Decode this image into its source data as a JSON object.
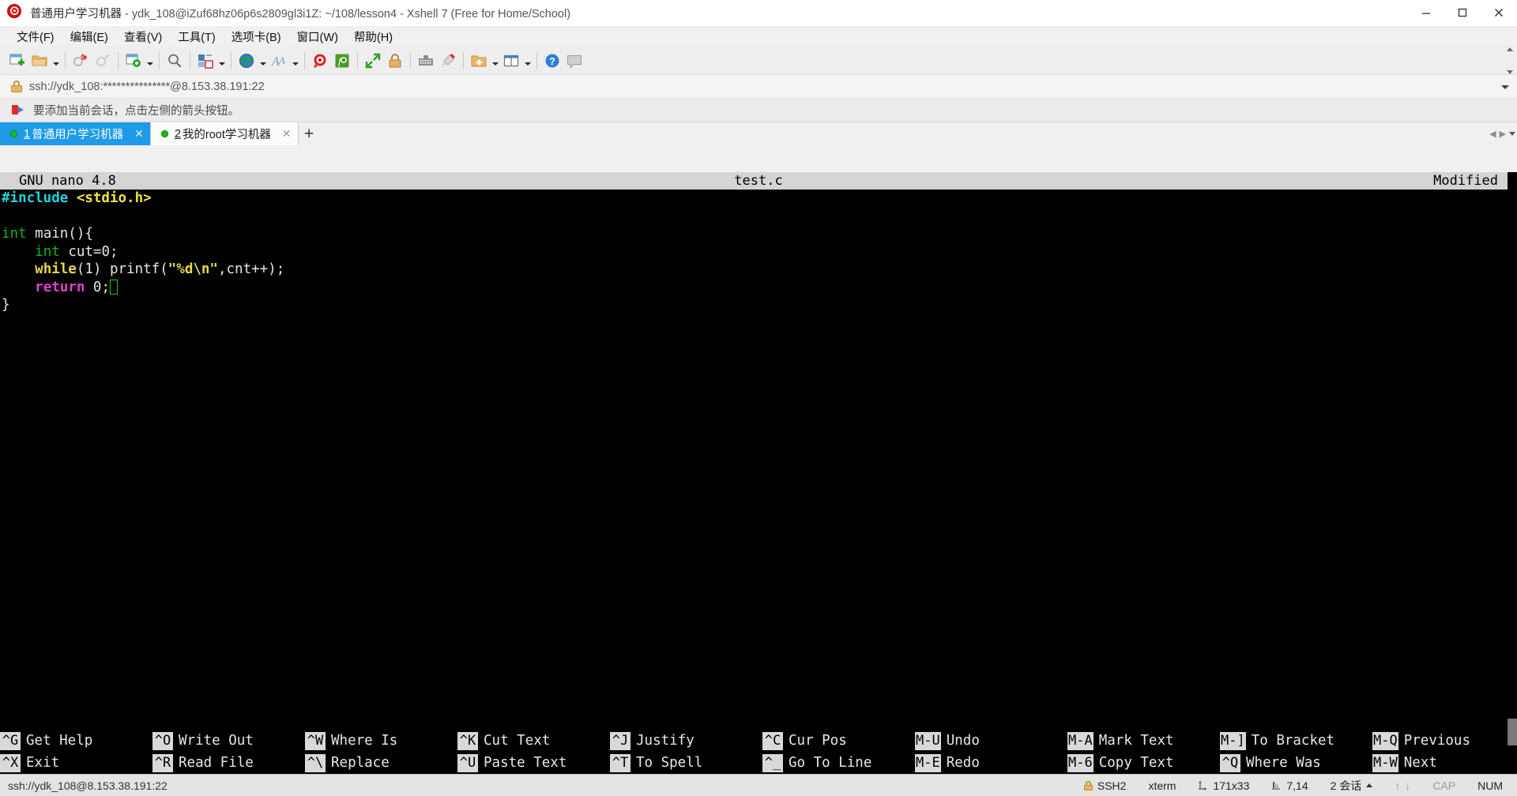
{
  "window": {
    "title_main": "普通用户学习机器",
    "title_rest": " - ydk_108@iZuf68hz06p6s2809gl3i1Z: ~/108/lesson4 - Xshell 7 (Free for Home/School)",
    "app_icon": "xshell-icon",
    "minimize_icon": "minimize-icon",
    "maximize_icon": "maximize-icon",
    "close_icon": "close-icon"
  },
  "menu": {
    "items": [
      {
        "label": "文件(F)",
        "name": "menu-file"
      },
      {
        "label": "编辑(E)",
        "name": "menu-edit"
      },
      {
        "label": "查看(V)",
        "name": "menu-view"
      },
      {
        "label": "工具(T)",
        "name": "menu-tools"
      },
      {
        "label": "选项卡(B)",
        "name": "menu-tab"
      },
      {
        "label": "窗口(W)",
        "name": "menu-window"
      },
      {
        "label": "帮助(H)",
        "name": "menu-help"
      }
    ]
  },
  "toolbar": {
    "buttons": [
      {
        "name": "new-session-icon"
      },
      {
        "name": "open-folder-icon"
      },
      {
        "name": "open-folder-dropdown-icon"
      },
      {
        "name": "disconnect-icon"
      },
      {
        "name": "reconnect-icon"
      },
      {
        "name": "session-properties-icon"
      },
      {
        "name": "session-properties-dropdown-icon"
      },
      {
        "name": "find-icon"
      },
      {
        "name": "layout-icon"
      },
      {
        "name": "layout-dropdown-icon"
      },
      {
        "name": "globe-icon"
      },
      {
        "name": "globe-dropdown-icon"
      },
      {
        "name": "font-icon"
      },
      {
        "name": "font-dropdown-icon"
      },
      {
        "name": "xshell-log-icon"
      },
      {
        "name": "xftp-icon"
      },
      {
        "name": "fullscreen-icon"
      },
      {
        "name": "lock-icon"
      },
      {
        "name": "keyboard-icon"
      },
      {
        "name": "highlight-icon"
      },
      {
        "name": "new-folder-icon"
      },
      {
        "name": "new-folder-dropdown-icon"
      },
      {
        "name": "grid-icon"
      },
      {
        "name": "grid-dropdown-icon"
      },
      {
        "name": "help-icon"
      },
      {
        "name": "chat-icon"
      }
    ],
    "scroll_up_icon": "toolbar-scroll-up-icon",
    "scroll_down_icon": "toolbar-scroll-down-icon"
  },
  "address_bar": {
    "lock_icon": "lock-icon",
    "value": "ssh://ydk_108:***************@8.153.38.191:22",
    "dropdown_icon": "chevron-down-icon"
  },
  "notice_bar": {
    "flag_icon": "flag-icon",
    "text": "要添加当前会话，点击左侧的箭头按钮。"
  },
  "tabs": {
    "items": [
      {
        "num": "1",
        "label": "普通用户学习机器",
        "active": true,
        "status": "connected",
        "close_icon": "close-icon"
      },
      {
        "num": "2",
        "label": "我的root学习机器",
        "active": false,
        "status": "connected",
        "close_icon": "close-icon"
      }
    ],
    "new_tab_label": "+",
    "nav_prev_icon": "chevron-left-icon",
    "nav_next_icon": "chevron-right-icon",
    "nav_list_icon": "chevron-down-icon"
  },
  "nano": {
    "version": "GNU nano 4.8",
    "filename": "test.c",
    "modified": "Modified",
    "code_lines": [
      [
        {
          "t": "#include ",
          "c": "c-cyan"
        },
        {
          "t": "<stdio.h>",
          "c": "c-yel"
        }
      ],
      [],
      [
        {
          "t": "int ",
          "c": "c-grn"
        },
        {
          "t": "main(){",
          "c": "c-wht"
        }
      ],
      [
        {
          "t": "    ",
          "c": "c-wht"
        },
        {
          "t": "int ",
          "c": "c-grn"
        },
        {
          "t": "cut=0;",
          "c": "c-wht"
        }
      ],
      [
        {
          "t": "    ",
          "c": "c-wht"
        },
        {
          "t": "while",
          "c": "c-yel2"
        },
        {
          "t": "(1) printf(",
          "c": "c-wht"
        },
        {
          "t": "\"%d\\n\"",
          "c": "c-yel2"
        },
        {
          "t": ",cnt++);",
          "c": "c-wht"
        }
      ],
      [
        {
          "t": "    ",
          "c": "c-wht"
        },
        {
          "t": "return ",
          "c": "c-mag"
        },
        {
          "t": "0;",
          "c": "c-wht"
        },
        {
          "t": "@CURSOR@",
          "c": "cursor"
        }
      ],
      [
        {
          "t": "}",
          "c": "c-wht"
        }
      ]
    ],
    "shortcuts_row1": [
      {
        "key": "^G",
        "label": "Get Help"
      },
      {
        "key": "^O",
        "label": "Write Out"
      },
      {
        "key": "^W",
        "label": "Where Is"
      },
      {
        "key": "^K",
        "label": "Cut Text"
      },
      {
        "key": "^J",
        "label": "Justify"
      },
      {
        "key": "^C",
        "label": "Cur Pos"
      },
      {
        "key": "M-U",
        "label": "Undo"
      },
      {
        "key": "M-A",
        "label": "Mark Text"
      },
      {
        "key": "M-]",
        "label": "To Bracket"
      },
      {
        "key": "M-Q",
        "label": "Previous"
      }
    ],
    "shortcuts_row2": [
      {
        "key": "^X",
        "label": "Exit"
      },
      {
        "key": "^R",
        "label": "Read File"
      },
      {
        "key": "^\\",
        "label": "Replace"
      },
      {
        "key": "^U",
        "label": "Paste Text"
      },
      {
        "key": "^T",
        "label": "To Spell"
      },
      {
        "key": "^_",
        "label": "Go To Line"
      },
      {
        "key": "M-E",
        "label": "Redo"
      },
      {
        "key": "M-6",
        "label": "Copy Text"
      },
      {
        "key": "^Q",
        "label": "Where Was"
      },
      {
        "key": "M-W",
        "label": "Next"
      }
    ]
  },
  "status_bar": {
    "connection": "ssh://ydk_108@8.153.38.191:22",
    "lock_icon": "lock-icon",
    "protocol": "SSH2",
    "term_type": "xterm",
    "size_icon": "resize-icon",
    "size": "171x33",
    "cursor_icon": "cursor-pos-icon",
    "cursor_pos": "7,14",
    "sessions": "2 会话",
    "sessions_caret_icon": "caret-up-icon",
    "upload_icon": "arrow-up-icon",
    "download_icon": "arrow-down-icon",
    "cap": "CAP",
    "num": "NUM"
  },
  "colors": {
    "accent": "#1e9ae6",
    "terminal_bg": "#000000",
    "nano_title_bg": "#d4d4d4",
    "connected_dot": "#18bd18",
    "cursor": "#22c522"
  }
}
